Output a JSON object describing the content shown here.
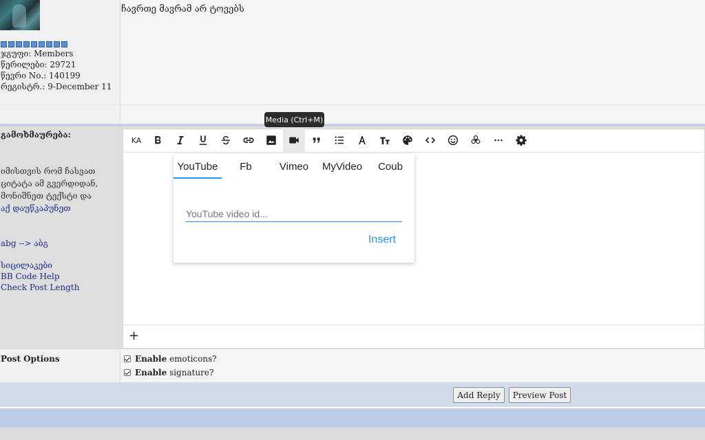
{
  "post": {
    "member_group": "ჯგუფი: Members",
    "posts": "წერილები: 29721",
    "member_no": "წევრი No.: 140199",
    "registered": "რეგისტრ.: 9-December 11",
    "text": "ჩავრთე მავრამ არ ტოვებს"
  },
  "reply_form": {
    "comment_label": "გამოხმაურება:",
    "quote_hint": [
      "იმისთვის რომ ჩასვათ",
      "ციტატა ამ გვერდიდან,",
      "მონიშნეთ ტექსტი და"
    ],
    "quote_link": "აქ დაუწკაპუნეთ",
    "translit_link": "abg --> აბგ",
    "smilies_link": "სიცილაკები",
    "bbcode_link": "BB Code Help",
    "check_length_link": "Check Post Length"
  },
  "toolbar": {
    "buttons": [
      {
        "name": "keyboard-layout",
        "label": "KA",
        "icon": "text-ka"
      },
      {
        "name": "bold",
        "icon": "bold-icon"
      },
      {
        "name": "italic",
        "icon": "italic-icon"
      },
      {
        "name": "underline",
        "icon": "underline-icon"
      },
      {
        "name": "strikethrough",
        "icon": "strikethrough-icon"
      },
      {
        "name": "link",
        "icon": "link-icon"
      },
      {
        "name": "image",
        "icon": "image-icon"
      },
      {
        "name": "media",
        "icon": "video-camera-icon",
        "active": true
      },
      {
        "name": "quote",
        "icon": "quote-icon"
      },
      {
        "name": "list",
        "icon": "list-icon"
      },
      {
        "name": "font",
        "icon": "font-icon"
      },
      {
        "name": "font-size",
        "icon": "text-size-icon"
      },
      {
        "name": "color",
        "icon": "palette-icon"
      },
      {
        "name": "code",
        "icon": "code-icon"
      },
      {
        "name": "emoji",
        "icon": "smiley-icon"
      },
      {
        "name": "spoiler",
        "icon": "biohazard-icon"
      },
      {
        "name": "more",
        "icon": "ellipsis-icon"
      },
      {
        "name": "settings",
        "icon": "gear-icon"
      }
    ],
    "tooltip": "Media (Ctrl+M)",
    "footer_add": "+"
  },
  "media_popup": {
    "tabs": [
      "YouTube",
      "Fb",
      "Vimeo",
      "MyVideo",
      "Coub"
    ],
    "active_tab": "YouTube",
    "input_placeholder": "YouTube video id...",
    "input_value": "",
    "insert_label": "Insert"
  },
  "post_options": {
    "label": "Post Options",
    "emoticons_bold": "Enable",
    "emoticons_rest": "emoticons?",
    "emoticons_checked": true,
    "signature_bold": "Enable",
    "signature_rest": "signature?",
    "signature_checked": true
  },
  "buttons": {
    "add_reply": "Add Reply",
    "preview_post": "Preview Post"
  },
  "colors": {
    "accent": "#2196f3",
    "reputation_pip": "#5a8fd6",
    "link": "#1a2a8a"
  }
}
